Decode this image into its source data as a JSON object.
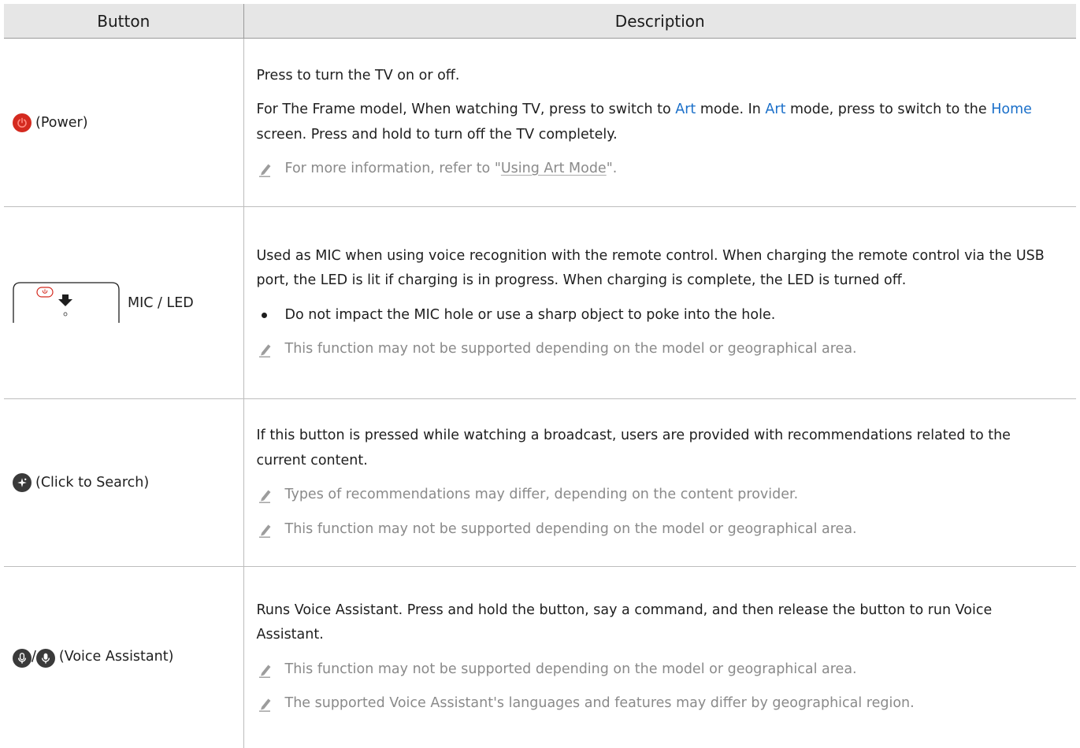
{
  "table": {
    "headers": {
      "button": "Button",
      "description": "Description"
    },
    "rows": [
      {
        "icon": "power-icon",
        "button_label": "(Power)",
        "desc1": "Press to turn the TV on or off.",
        "desc2": {
          "t1": "For The Frame model, When watching TV, press to switch to ",
          "art1": "Art",
          "t2": " mode. In ",
          "art2": "Art",
          "t3": " mode, press to switch to the ",
          "home": "Home",
          "t4": " screen. Press and hold to turn off the TV completely."
        },
        "note": {
          "pre": "For more information, refer to \"",
          "link": "Using Art Mode",
          "post": "\"."
        }
      },
      {
        "icon": "mic-led-icon",
        "button_label": "MIC / LED",
        "desc": "Used as MIC when using voice recognition with the remote control. When charging the remote control via the USB port, the LED is lit if charging is in progress. When charging is complete, the LED is turned off.",
        "bullet": "Do not impact the MIC hole or use a sharp object to poke into the hole.",
        "note": "This function may not be supported depending on the model or geographical area."
      },
      {
        "icon": "click-to-search-icon",
        "button_label": "(Click to Search)",
        "desc": "If this button is pressed while watching a broadcast, users are provided with recommendations related to the current content.",
        "note1": "Types of recommendations may differ, depending on the content provider.",
        "note2": "This function may not be supported depending on the model or geographical area."
      },
      {
        "icon": "voice-assistant-icon",
        "separator": "/",
        "button_label": "(Voice Assistant)",
        "desc": "Runs Voice Assistant. Press and hold the button, say a command, and then release the button to run Voice Assistant.",
        "note1": "This function may not be supported depending on the model or geographical area.",
        "note2": "The supported Voice Assistant's languages and features may differ by geographical region."
      }
    ]
  }
}
